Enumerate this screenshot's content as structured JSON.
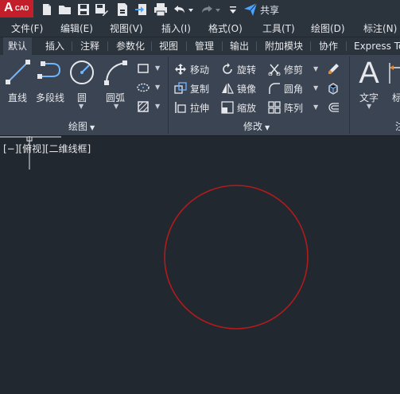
{
  "app": {
    "logo_letter": "A",
    "logo_text": "CAD"
  },
  "quick_access": {
    "icons": [
      "new-file-icon",
      "open-folder-icon",
      "save-icon",
      "save-as-icon",
      "publish-icon",
      "export-icon",
      "print-icon",
      "undo-icon",
      "redo-icon",
      "customize-dropdown-icon"
    ],
    "share_label": "共享"
  },
  "menu": {
    "items": [
      "文件(F)",
      "编辑(E)",
      "视图(V)",
      "插入(I)",
      "格式(O)",
      "工具(T)",
      "绘图(D)",
      "标注(N)"
    ]
  },
  "tabs": {
    "items": [
      "默认",
      "插入",
      "注释",
      "参数化",
      "视图",
      "管理",
      "输出",
      "附加模块",
      "协作",
      "Express To"
    ],
    "active": "默认"
  },
  "ribbon": {
    "draw_panel": {
      "title": "绘图",
      "line": "直线",
      "polyline": "多段线",
      "circle": "圆",
      "arc": "圆弧"
    },
    "modify_panel": {
      "title": "修改",
      "move": "移动",
      "rotate": "旋转",
      "trim": "修剪",
      "copy": "复制",
      "mirror": "镜像",
      "fillet": "圆角",
      "stretch": "拉伸",
      "scale": "缩放",
      "array": "阵列"
    },
    "annotation_panel": {
      "text": "文字",
      "dim_partial": "标",
      "title_partial": "注"
    }
  },
  "viewport": {
    "label": "[−][俯视][二维线框]",
    "circle_color": "#b31b1b",
    "background": "#212830"
  }
}
